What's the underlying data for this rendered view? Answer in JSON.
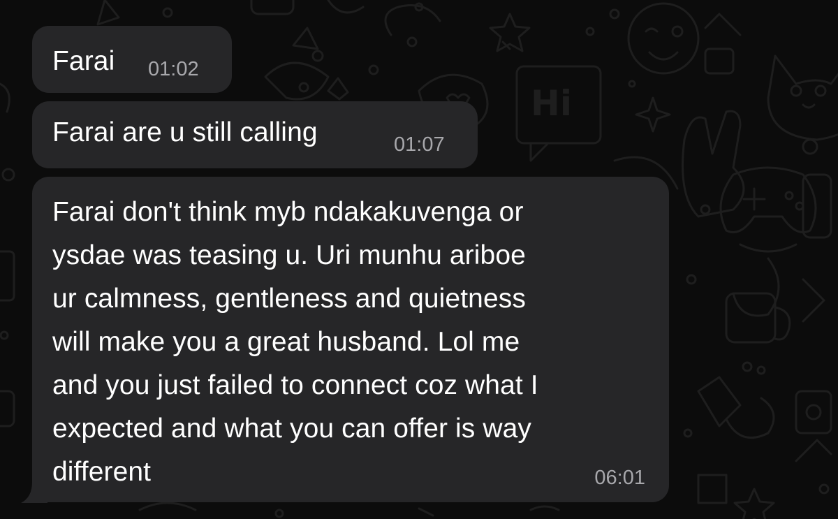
{
  "theme": {
    "background": "#0c0c0c",
    "bubble_color": "#262628",
    "text_color": "#ffffff",
    "time_color": "#a8a8ac"
  },
  "wallpaper": {
    "doodle_text": "Hi"
  },
  "messages": [
    {
      "text": "Farai",
      "time": "01:02"
    },
    {
      "text": "Farai are u still calling",
      "time": "01:07"
    },
    {
      "text": "Farai don't think myb ndakakuvenga or\nysdae was teasing u. Uri munhu ariboe\nur calmness, gentleness and quietness\nwill make you a great husband. Lol me\nand you just failed to connect coz what I\nexpected and what you can offer is way\ndifferent",
      "time": "06:01"
    }
  ]
}
